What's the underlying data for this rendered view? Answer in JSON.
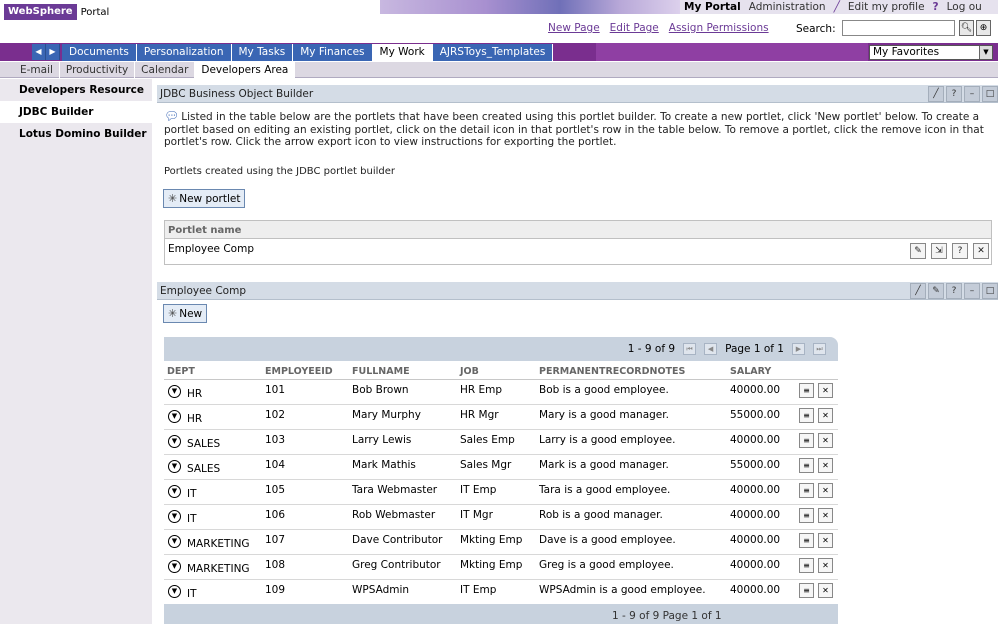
{
  "header": {
    "logo_brand": "WebSphere",
    "logo_product": "Portal",
    "top_links": {
      "my_portal": "My Portal",
      "administration": "Administration",
      "edit_profile": "Edit my profile",
      "log_out": "Log ou"
    },
    "actions": {
      "new_page": "New Page",
      "edit_page": "Edit Page",
      "assign_permissions": "Assign Permissions"
    },
    "search": {
      "label": "Search:",
      "value": ""
    }
  },
  "main_nav": {
    "tabs": [
      {
        "label": "Documents"
      },
      {
        "label": "Personalization"
      },
      {
        "label": "My Tasks"
      },
      {
        "label": "My Finances"
      },
      {
        "label": "My Work"
      },
      {
        "label": "AJRSToys_Templates"
      }
    ],
    "active_index": 4,
    "favorites": "My Favorites"
  },
  "sub_nav": {
    "tabs": [
      {
        "label": "E-mail"
      },
      {
        "label": "Productivity"
      },
      {
        "label": "Calendar"
      },
      {
        "label": "Developers Area"
      }
    ],
    "active_index": 3
  },
  "left_nav": {
    "items": [
      {
        "label": "Developers Resource"
      },
      {
        "label": "JDBC Builder"
      },
      {
        "label": "Lotus Domino Builder"
      }
    ],
    "selected_index": 1
  },
  "jdbc_portlet": {
    "title": "JDBC Business Object Builder",
    "intro": "Listed in the table below are the portlets that have been created using this portlet builder. To create a new portlet, click 'New portlet' below. To create a portlet based on editing an existing portlet, click on the detail icon in that portlet's row in the table below. To remove a portlet, click the remove icon in that portlet's row. Click the arrow export icon to view instructions for exporting the portlet.",
    "created_label": "Portlets created using the JDBC portlet builder",
    "new_button": "New portlet",
    "list_header": "Portlet name",
    "rows": [
      {
        "name": "Employee Comp"
      }
    ]
  },
  "employee_portlet": {
    "title": "Employee Comp",
    "new_button": "New",
    "paging": {
      "range": "1 - 9 of 9",
      "page": "Page 1 of 1"
    },
    "paging_bottom": "1 - 9 of 9      Page 1 of 1",
    "columns": [
      "DEPT",
      "EMPLOYEEID",
      "FULLNAME",
      "JOB",
      "PERMANENTRECORDNOTES",
      "SALARY"
    ],
    "rows": [
      {
        "dept": "HR",
        "id": "101",
        "name": "Bob Brown",
        "job": "HR Emp",
        "notes": "Bob is a good employee.",
        "salary": "40000.00"
      },
      {
        "dept": "HR",
        "id": "102",
        "name": "Mary Murphy",
        "job": "HR Mgr",
        "notes": "Mary is a good manager.",
        "salary": "55000.00"
      },
      {
        "dept": "SALES",
        "id": "103",
        "name": "Larry Lewis",
        "job": "Sales Emp",
        "notes": "Larry is a good employee.",
        "salary": "40000.00"
      },
      {
        "dept": "SALES",
        "id": "104",
        "name": "Mark Mathis",
        "job": "Sales Mgr",
        "notes": "Mark is a good manager.",
        "salary": "55000.00"
      },
      {
        "dept": "IT",
        "id": "105",
        "name": "Tara Webmaster",
        "job": "IT Emp",
        "notes": "Tara is a good employee.",
        "salary": "40000.00"
      },
      {
        "dept": "IT",
        "id": "106",
        "name": "Rob Webmaster",
        "job": "IT Mgr",
        "notes": "Rob is a good manager.",
        "salary": "40000.00"
      },
      {
        "dept": "MARKETING",
        "id": "107",
        "name": "Dave Contributor",
        "job": "Mkting Emp",
        "notes": "Dave is a good employee.",
        "salary": "40000.00"
      },
      {
        "dept": "MARKETING",
        "id": "108",
        "name": "Greg Contributor",
        "job": "Mkting Emp",
        "notes": "Greg is a good employee.",
        "salary": "40000.00"
      },
      {
        "dept": "IT",
        "id": "109",
        "name": "WPSAdmin",
        "job": "IT Emp",
        "notes": "WPSAdmin is a good employee.",
        "salary": "40000.00"
      }
    ]
  },
  "icons": {
    "search": "search-icon",
    "advanced_search": "advanced-search-icon",
    "tool": "tool-icon",
    "edit": "pencil-icon",
    "help": "help-icon",
    "minimize": "minimize-icon",
    "maximize": "maximize-icon",
    "detail": "detail-icon",
    "export": "export-icon",
    "delete": "trash-icon",
    "info": "speech-bubble-icon",
    "expand": "chevron-down-icon"
  },
  "colors": {
    "brand_purple": "#7a2e8e",
    "tab_blue": "#3a66b4",
    "title_bar": "#d4dce6"
  }
}
